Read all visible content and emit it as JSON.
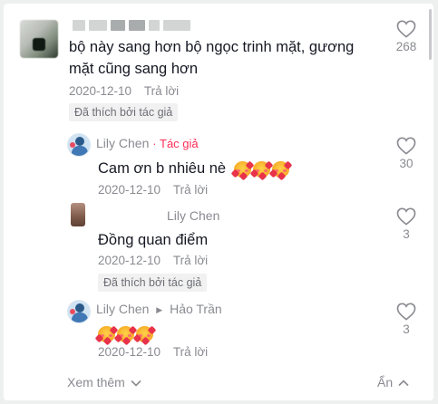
{
  "comments": [
    {
      "text": "bộ này sang hơn bộ ngọc trinh mặt, gương mặt cũng sang hơn",
      "line1": "bộ này sang hơn bộ ngọc trinh mặt, gương",
      "line2": "mặt cũng sang hơn",
      "date": "2020-12-10",
      "reply_label": "Trả lời",
      "liked_badge": "Đã thích bởi tác giả",
      "likes": "268"
    },
    {
      "username": "Lily Chen",
      "separator": "·",
      "author_tag": "Tác giả",
      "text": "Cam ơn b nhiêu nè",
      "emoji_count": 3,
      "date": "2020-12-10",
      "reply_label": "Trả lời",
      "likes": "30"
    },
    {
      "username": "Lily Chen",
      "text": "Đồng quan điểm",
      "date": "2020-12-10",
      "reply_label": "Trả lời",
      "liked_badge": "Đã thích bởi tác giả",
      "likes": "3"
    },
    {
      "username": "Lily Chen",
      "reply_to": "Hảo Trần",
      "emoji_count": 3,
      "date": "2020-12-10",
      "reply_label": "Trả lời",
      "likes": "3"
    }
  ],
  "footer": {
    "see_more": "Xem thêm",
    "hide": "Ẩn"
  },
  "colors": {
    "author_tag": "#fe2c55",
    "text": "#161823",
    "muted": "#8a8b91"
  }
}
